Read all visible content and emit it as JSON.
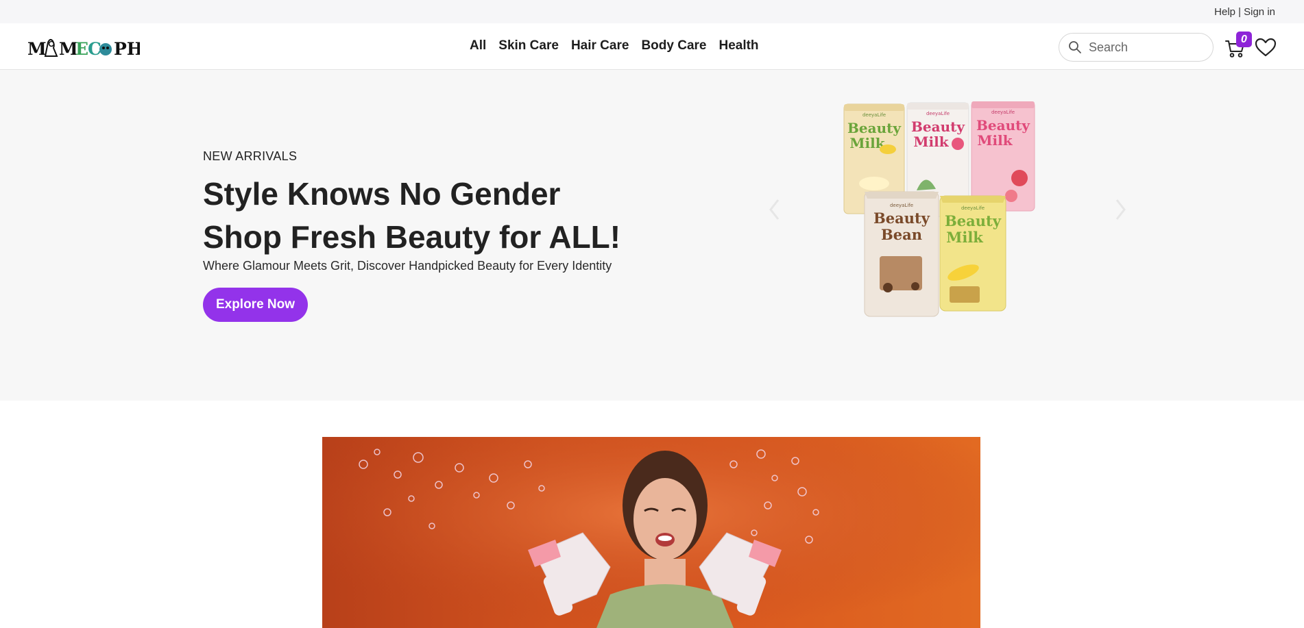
{
  "topbar": {
    "help": "Help",
    "separator": "|",
    "signin": "Sign in"
  },
  "header": {
    "logo_text": "MAMECOPH",
    "nav": [
      "All",
      "Skin Care",
      "Hair Care",
      "Body Care",
      "Health"
    ],
    "search_placeholder": "Search",
    "cart_count": "0"
  },
  "hero": {
    "eyebrow": "NEW ARRIVALS",
    "title_line1": "Style Knows No Gender",
    "title_line2": "Shop Fresh Beauty for ALL!",
    "subtitle": "Where Glamour Meets Grit, Discover Handpicked Beauty for Every Identity",
    "cta": "Explore Now",
    "products": [
      {
        "brand": "deeyaLife",
        "name_line1": "Beauty",
        "name_line2": "Milk"
      },
      {
        "brand": "deeyaLife",
        "name_line1": "Beauty",
        "name_line2": "Milk"
      },
      {
        "brand": "deeyaLife",
        "name_line1": "Beauty",
        "name_line2": "Milk"
      },
      {
        "brand": "deeyaLife",
        "name_line1": "Beauty",
        "name_line2": "Bean"
      },
      {
        "brand": "deeyaLife",
        "name_line1": "Beauty",
        "name_line2": "Milk"
      }
    ]
  },
  "colors": {
    "accent": "#9333ea",
    "badge": "#8e24d8",
    "hero_bg": "#f7f7f7",
    "promo_bg": "#d9581f"
  },
  "icons": [
    "search-icon",
    "cart-icon",
    "heart-icon",
    "chevron-left-icon",
    "chevron-right-icon"
  ]
}
